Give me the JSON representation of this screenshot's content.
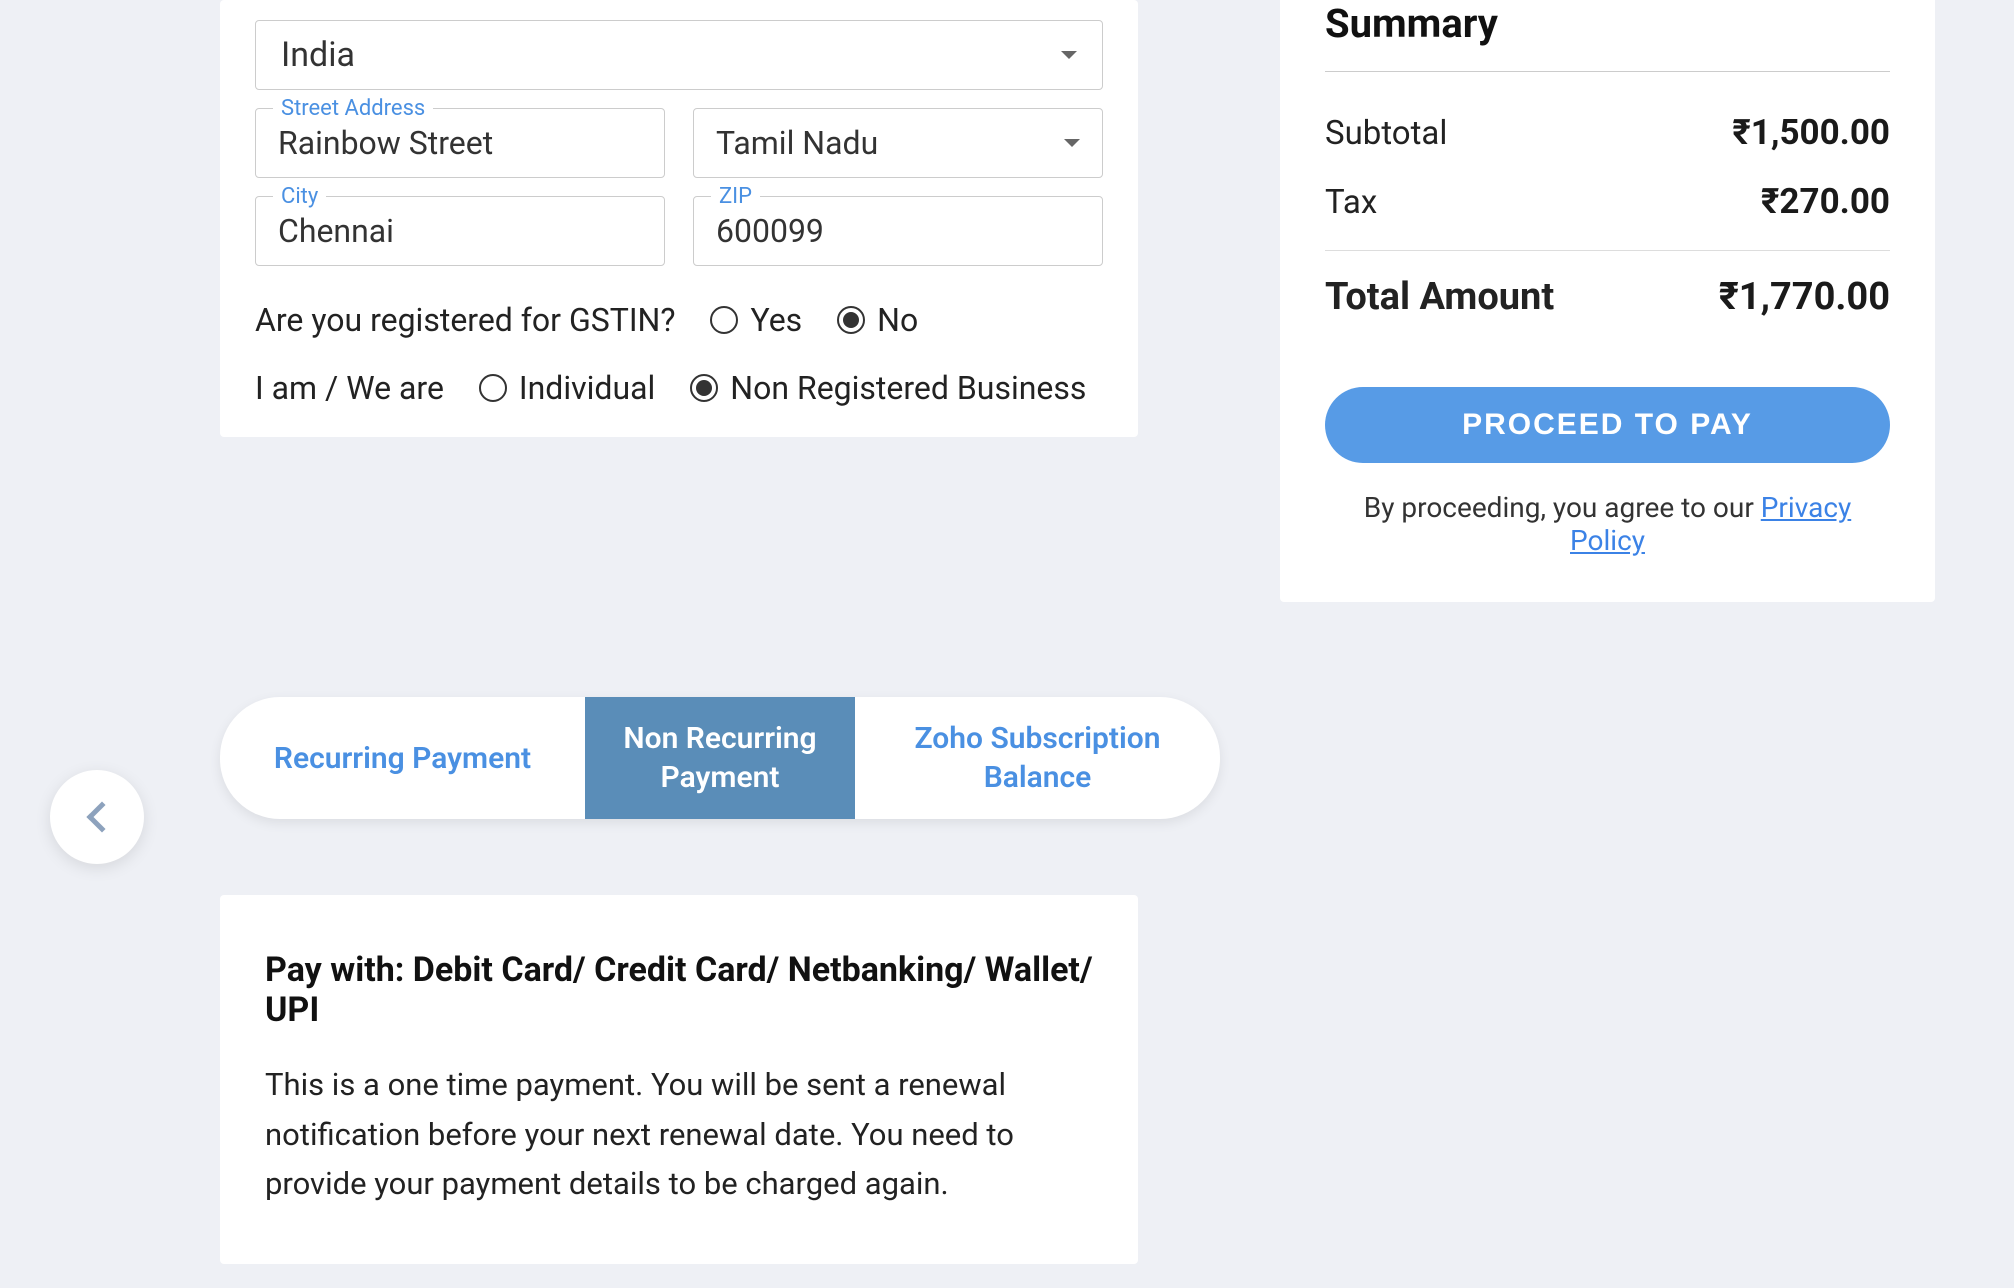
{
  "form": {
    "country": "India",
    "streetLabel": "Street Address",
    "street": "Rainbow Street",
    "state": "Tamil Nadu",
    "cityLabel": "City",
    "city": "Chennai",
    "zipLabel": "ZIP",
    "zip": "600099",
    "gstinQuestion": "Are you registered for GSTIN?",
    "yes": "Yes",
    "no": "No",
    "iamQuestion": "I am / We are",
    "individual": "Individual",
    "nonRegBiz": "Non Registered Business"
  },
  "summary": {
    "title": "Summary",
    "subtotalLabel": "Subtotal",
    "subtotalValue": "₹1,500.00",
    "taxLabel": "Tax",
    "taxValue": "₹270.00",
    "totalLabel": "Total Amount",
    "totalValue": "₹1,770.00",
    "proceed": "PROCEED TO PAY",
    "agreeText": "By proceeding, you agree to our ",
    "privacy": "Privacy Policy"
  },
  "tabs": {
    "recurring": "Recurring Payment",
    "nonRecurring": "Non Recurring Payment",
    "balance": "Zoho Subscription Balance"
  },
  "payment": {
    "heading": "Pay with: Debit Card/ Credit Card/ Netbanking/ Wallet/ UPI",
    "description": "This is a one time payment. You will be sent a renewal notification before your next renewal date. You need to provide your payment details to be charged again."
  }
}
